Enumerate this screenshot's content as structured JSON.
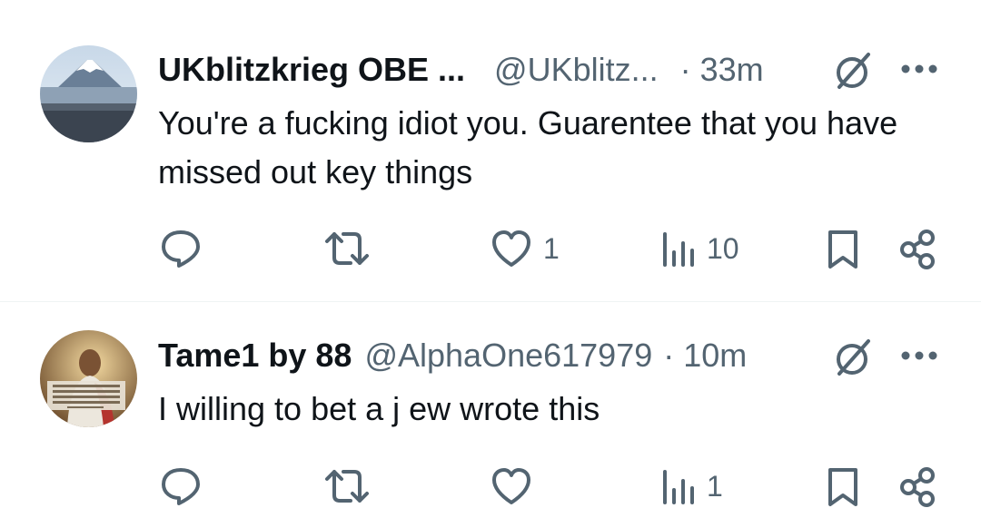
{
  "colors": {
    "text": "#0f1419",
    "secondary": "#536471",
    "divider": "#eff3f4"
  },
  "posts": [
    {
      "display_name": "UKblitzkrieg OBE ...",
      "handle": "@UKblitz...",
      "separator": "·",
      "time": "33m",
      "text": "You're a fucking idiot you. Guarentee that you have missed out key things",
      "avatar": "mount-fuji-photo",
      "actions": {
        "reply_icon": "reply-icon",
        "repost_icon": "repost-icon",
        "like_icon": "heart-icon",
        "like_count": "1",
        "views_icon": "views-icon",
        "views_count": "10",
        "bookmark_icon": "bookmark-icon",
        "share_icon": "share-icon"
      }
    },
    {
      "display_name": "Tame1 by 88",
      "handle": "@AlphaOne617979",
      "separator": "·",
      "time": "10m",
      "text": "I willing to bet a j ew wrote this",
      "avatar": "jesus-painting",
      "actions": {
        "reply_icon": "reply-icon",
        "repost_icon": "repost-icon",
        "like_icon": "heart-icon",
        "like_count": "",
        "views_icon": "views-icon",
        "views_count": "1",
        "bookmark_icon": "bookmark-icon",
        "share_icon": "share-icon"
      }
    }
  ]
}
